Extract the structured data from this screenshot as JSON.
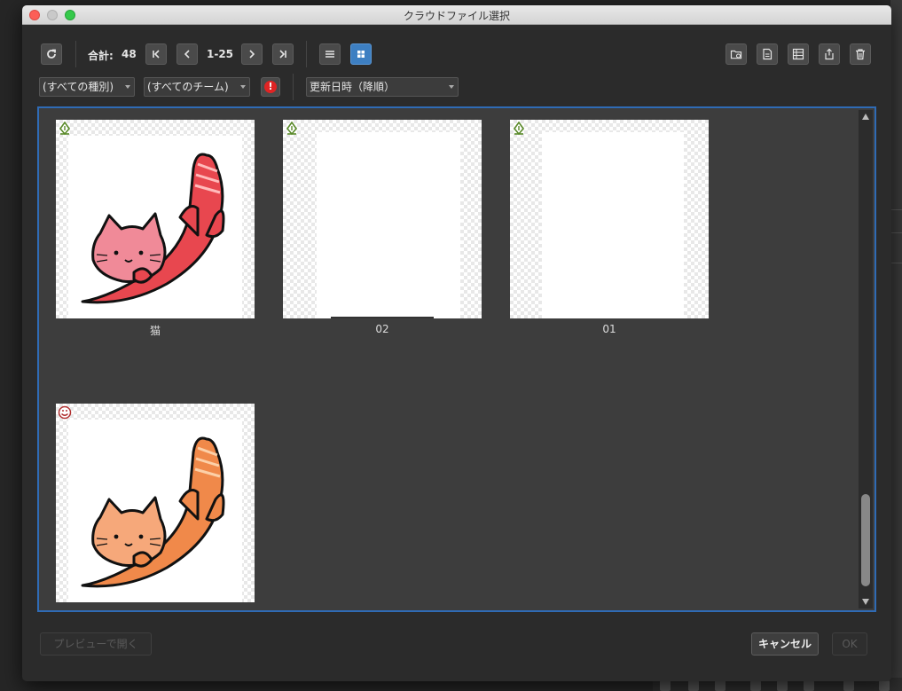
{
  "window": {
    "title": "クラウドファイル選択"
  },
  "toolbar": {
    "total_label": "合計:",
    "total_count": "48",
    "page_range": "1-25",
    "refresh_icon": "refresh-icon",
    "first_page_icon": "first-page-icon",
    "prev_page_icon": "prev-page-icon",
    "next_page_icon": "next-page-icon",
    "last_page_icon": "last-page-icon",
    "list_view_icon": "list-view-icon",
    "grid_view_icon": "grid-view-icon",
    "grid_view_active": true,
    "right_actions": [
      "open-folder-icon",
      "document-icon",
      "properties-icon",
      "share-icon",
      "trash-icon"
    ]
  },
  "filters": {
    "kind": "(すべての種別)",
    "team": "(すべてのチーム)",
    "alert_icon": "exclamation-icon",
    "sort": "更新日時（降順）"
  },
  "files": [
    {
      "name": "猫",
      "type_icon": "pen-nib-icon",
      "thumbnail": "red-cat-illustration"
    },
    {
      "name": "02",
      "type_icon": "pen-nib-icon",
      "thumbnail": "blank-canvas"
    },
    {
      "name": "01",
      "type_icon": "pen-nib-icon",
      "thumbnail": "blank-canvas"
    },
    {
      "name": "",
      "type_icon": "face-icon",
      "thumbnail": "orange-cat-illustration"
    }
  ],
  "footer": {
    "open_preview": "プレビューで開く",
    "cancel": "キャンセル",
    "ok": "OK"
  },
  "colors": {
    "accent": "#2f6bb5",
    "active_button": "#3d7fc2",
    "alert": "#e02424",
    "cat_red": "#e8474f",
    "cat_orange": "#f0894a"
  }
}
